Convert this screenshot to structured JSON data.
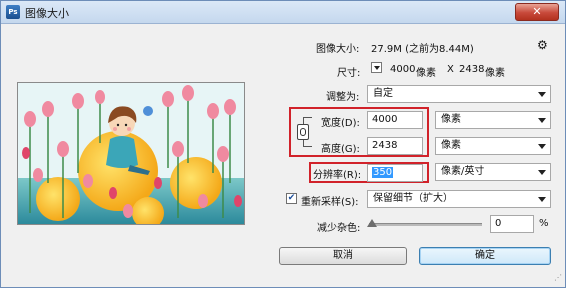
{
  "window": {
    "title": "图像大小",
    "close_label": "✕"
  },
  "image_size": {
    "label": "图像大小:",
    "value": "27.9M (之前为8.44M)"
  },
  "dimensions": {
    "label": "尺寸:",
    "width": "4000",
    "x": "X",
    "height": "2438",
    "unit": "像素"
  },
  "fit_to": {
    "label": "调整为:",
    "value": "自定"
  },
  "width": {
    "label": "宽度(D):",
    "value": "4000",
    "unit": "像素"
  },
  "height": {
    "label": "高度(G):",
    "value": "2438",
    "unit": "像素"
  },
  "resolution": {
    "label": "分辨率(R):",
    "value": "350",
    "unit": "像素/英寸"
  },
  "resample": {
    "label": "重新采样(S):",
    "checked": true,
    "value": "保留细节（扩大）"
  },
  "noise": {
    "label": "减少杂色:",
    "value": "0",
    "unit": "%",
    "level": 0
  },
  "buttons": {
    "cancel": "取消",
    "ok": "确定"
  },
  "colors": {
    "highlight": "#d1222a",
    "selection": "#3399ff"
  }
}
